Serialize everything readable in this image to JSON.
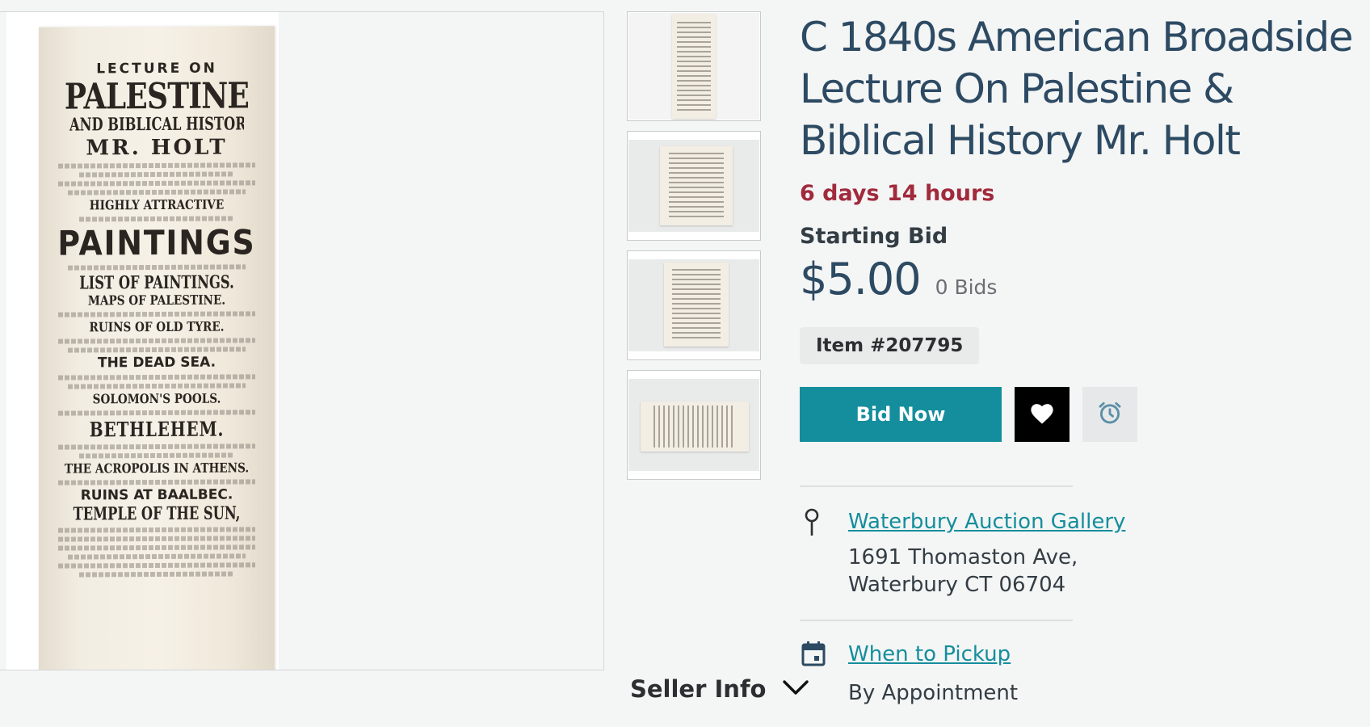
{
  "listing": {
    "title": "C 1840s American Broadside Lecture On Palestine & Biblical History Mr. Holt",
    "time_left": "6 days 14 hours",
    "starting_bid_label": "Starting Bid",
    "starting_bid": "$5.00",
    "bid_count": "0 Bids",
    "item_number": "Item #207795"
  },
  "poster_lines": {
    "line1": "LECTURE ON",
    "line2": "PALESTINE",
    "line3": "AND BIBLICAL HISTORY.",
    "line4": "MR. HOLT",
    "line5": "HIGHLY ATTRACTIVE",
    "line6": "PAINTINGS",
    "line7": "LIST OF PAINTINGS.",
    "line8": "MAPS OF PALESTINE.",
    "line9": "RUINS OF OLD TYRE.",
    "line10": "THE DEAD SEA.",
    "line11": "SOLOMON'S POOLS.",
    "line12": "BETHLEHEM.",
    "line13": "THE ACROPOLIS IN ATHENS.",
    "line14": "RUINS AT BAALBEC.",
    "line15": "TEMPLE OF THE SUN,"
  },
  "actions": {
    "bid_now": "Bid Now"
  },
  "location": {
    "name": "Waterbury Auction Gallery",
    "address_line1": "1691 Thomaston Ave,",
    "address_line2": "Waterbury CT 06704"
  },
  "pickup": {
    "label": "When to Pickup",
    "detail": "By Appointment"
  },
  "seller": {
    "label": "Seller Info"
  },
  "colors": {
    "accent": "#148e9c",
    "title": "#2d4a63",
    "time_left": "#a12a3c"
  },
  "icons": {
    "favorite": "heart-icon",
    "reminder": "alarm-clock-icon",
    "location": "map-pin-icon",
    "pickup": "calendar-icon",
    "seller_toggle": "chevron-down-icon"
  }
}
